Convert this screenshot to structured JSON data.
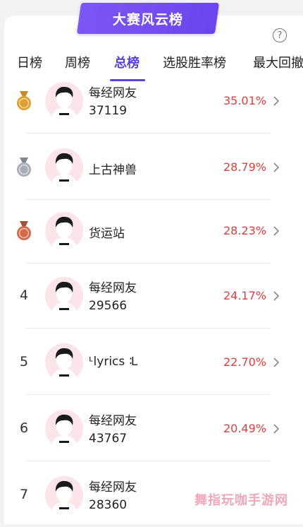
{
  "banner": {
    "title": "大赛风云榜"
  },
  "help_icon": "?",
  "tabs": [
    {
      "label": "日榜",
      "active": false
    },
    {
      "label": "周榜",
      "active": false
    },
    {
      "label": "总榜",
      "active": true
    },
    {
      "label": "选股胜率榜",
      "active": false
    },
    {
      "label": "最大回撤",
      "active": false
    }
  ],
  "rows": [
    {
      "rank": "",
      "medal": "gold-medal-icon",
      "name": "每经网友",
      "sub": "37119",
      "pct": "35.01%"
    },
    {
      "rank": "",
      "medal": "silver-medal-icon",
      "name": "上古神兽",
      "sub": "",
      "pct": "28.79%"
    },
    {
      "rank": "",
      "medal": "bronze-medal-icon",
      "name": "货运站",
      "sub": "",
      "pct": "28.23%"
    },
    {
      "rank": "4",
      "medal": "",
      "name": "每经网友",
      "sub": "29566",
      "pct": "24.17%"
    },
    {
      "rank": "5",
      "medal": "",
      "name": "ᒻlyrics ᒺ",
      "sub": "",
      "pct": "22.70%"
    },
    {
      "rank": "6",
      "medal": "",
      "name": "每经网友",
      "sub": "43767",
      "pct": "20.49%"
    },
    {
      "rank": "7",
      "medal": "",
      "name": "每经网友",
      "sub": "28360",
      "pct": ""
    }
  ],
  "watermark": "舞指玩咖手游网",
  "colors": {
    "accent": "#5b3fe0",
    "banner": "#7d57f4",
    "percent": "#d94040",
    "gold": "#e0a030",
    "silver": "#a8adb8",
    "bronze": "#d26a4a"
  }
}
